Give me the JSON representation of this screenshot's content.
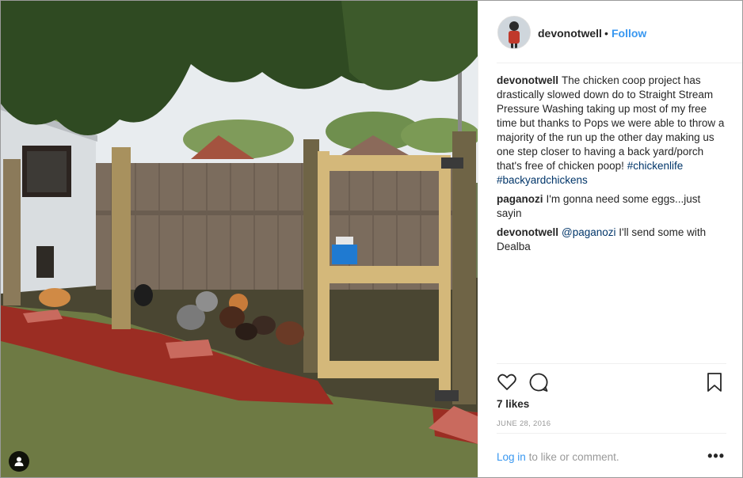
{
  "post": {
    "username": "devonotwell",
    "separator": "•",
    "follow_label": "Follow",
    "photo_alt": "Backyard chicken run with wooden fence and new gate"
  },
  "comments": [
    {
      "username": "devonotwell",
      "text": "The chicken coop project has drastically slowed down do to Straight Stream Pressure Washing taking up most of my free time but thanks to Pops we were able to throw a majority of the run up the other day making us one step closer to having a back yard/porch that's free of chicken poop!",
      "hashtags": [
        "#chickenlife",
        "#backyardchickens"
      ]
    },
    {
      "username": "paganozi",
      "text": "I'm gonna need some eggs...just sayin"
    },
    {
      "username": "devonotwell",
      "mention": "@paganozi",
      "text": "I'll send some with Dealba"
    }
  ],
  "stats": {
    "likes": "7 likes",
    "date": "JUNE 28, 2016"
  },
  "footer": {
    "login_label": "Log in",
    "login_suffix": "to like or comment.",
    "more_label": "•••"
  },
  "icons": {
    "like": "heart-icon",
    "comment": "comment-bubble-icon",
    "save": "bookmark-icon",
    "tag": "user-tag-icon"
  },
  "colors": {
    "link_blue": "#3897f0",
    "hashtag_blue": "#003569",
    "text": "#262626",
    "muted": "#999999"
  }
}
